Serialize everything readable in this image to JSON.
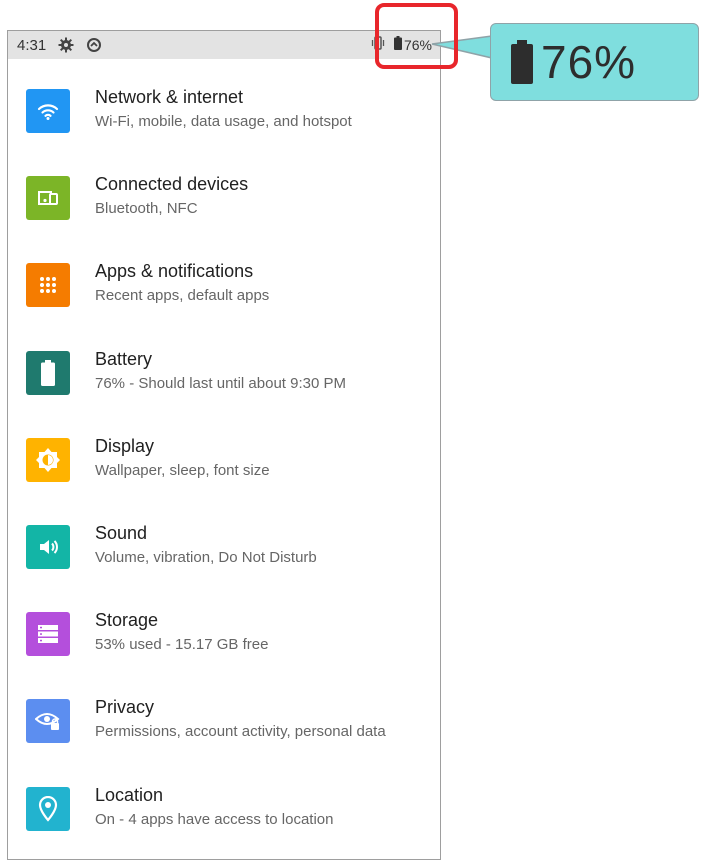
{
  "status_bar": {
    "time": "4:31",
    "icons": [
      "gear-icon",
      "data-saver-icon",
      "vibrate-icon",
      "battery-icon"
    ],
    "battery_text": "76%"
  },
  "callout": {
    "text": "76%",
    "icon": "battery-icon",
    "background": "#7fdede",
    "highlight_color": "#e8262b"
  },
  "settings": {
    "items": [
      {
        "title": "Network & internet",
        "subtitle": "Wi-Fi, mobile, data usage, and hotspot",
        "icon": "wifi-icon",
        "color": "#2196f3"
      },
      {
        "title": "Connected devices",
        "subtitle": "Bluetooth, NFC",
        "icon": "connected-devices-icon",
        "color": "#7cb527"
      },
      {
        "title": "Apps & notifications",
        "subtitle": "Recent apps, default apps",
        "icon": "apps-grid-icon",
        "color": "#f57c00"
      },
      {
        "title": "Battery",
        "subtitle": "76% - Should last until about 9:30 PM",
        "icon": "battery-icon",
        "color": "#1f7a6e"
      },
      {
        "title": "Display",
        "subtitle": "Wallpaper, sleep, font size",
        "icon": "brightness-icon",
        "color": "#ffb300"
      },
      {
        "title": "Sound",
        "subtitle": "Volume, vibration, Do Not Disturb",
        "icon": "volume-icon",
        "color": "#13b5a6"
      },
      {
        "title": "Storage",
        "subtitle": "53% used - 15.17 GB free",
        "icon": "storage-icon",
        "color": "#b44fdc"
      },
      {
        "title": "Privacy",
        "subtitle": "Permissions, account activity, personal data",
        "icon": "privacy-eye-icon",
        "color": "#5c8ef0"
      },
      {
        "title": "Location",
        "subtitle": "On - 4 apps have access to location",
        "icon": "location-pin-icon",
        "color": "#22b3cf"
      }
    ]
  }
}
